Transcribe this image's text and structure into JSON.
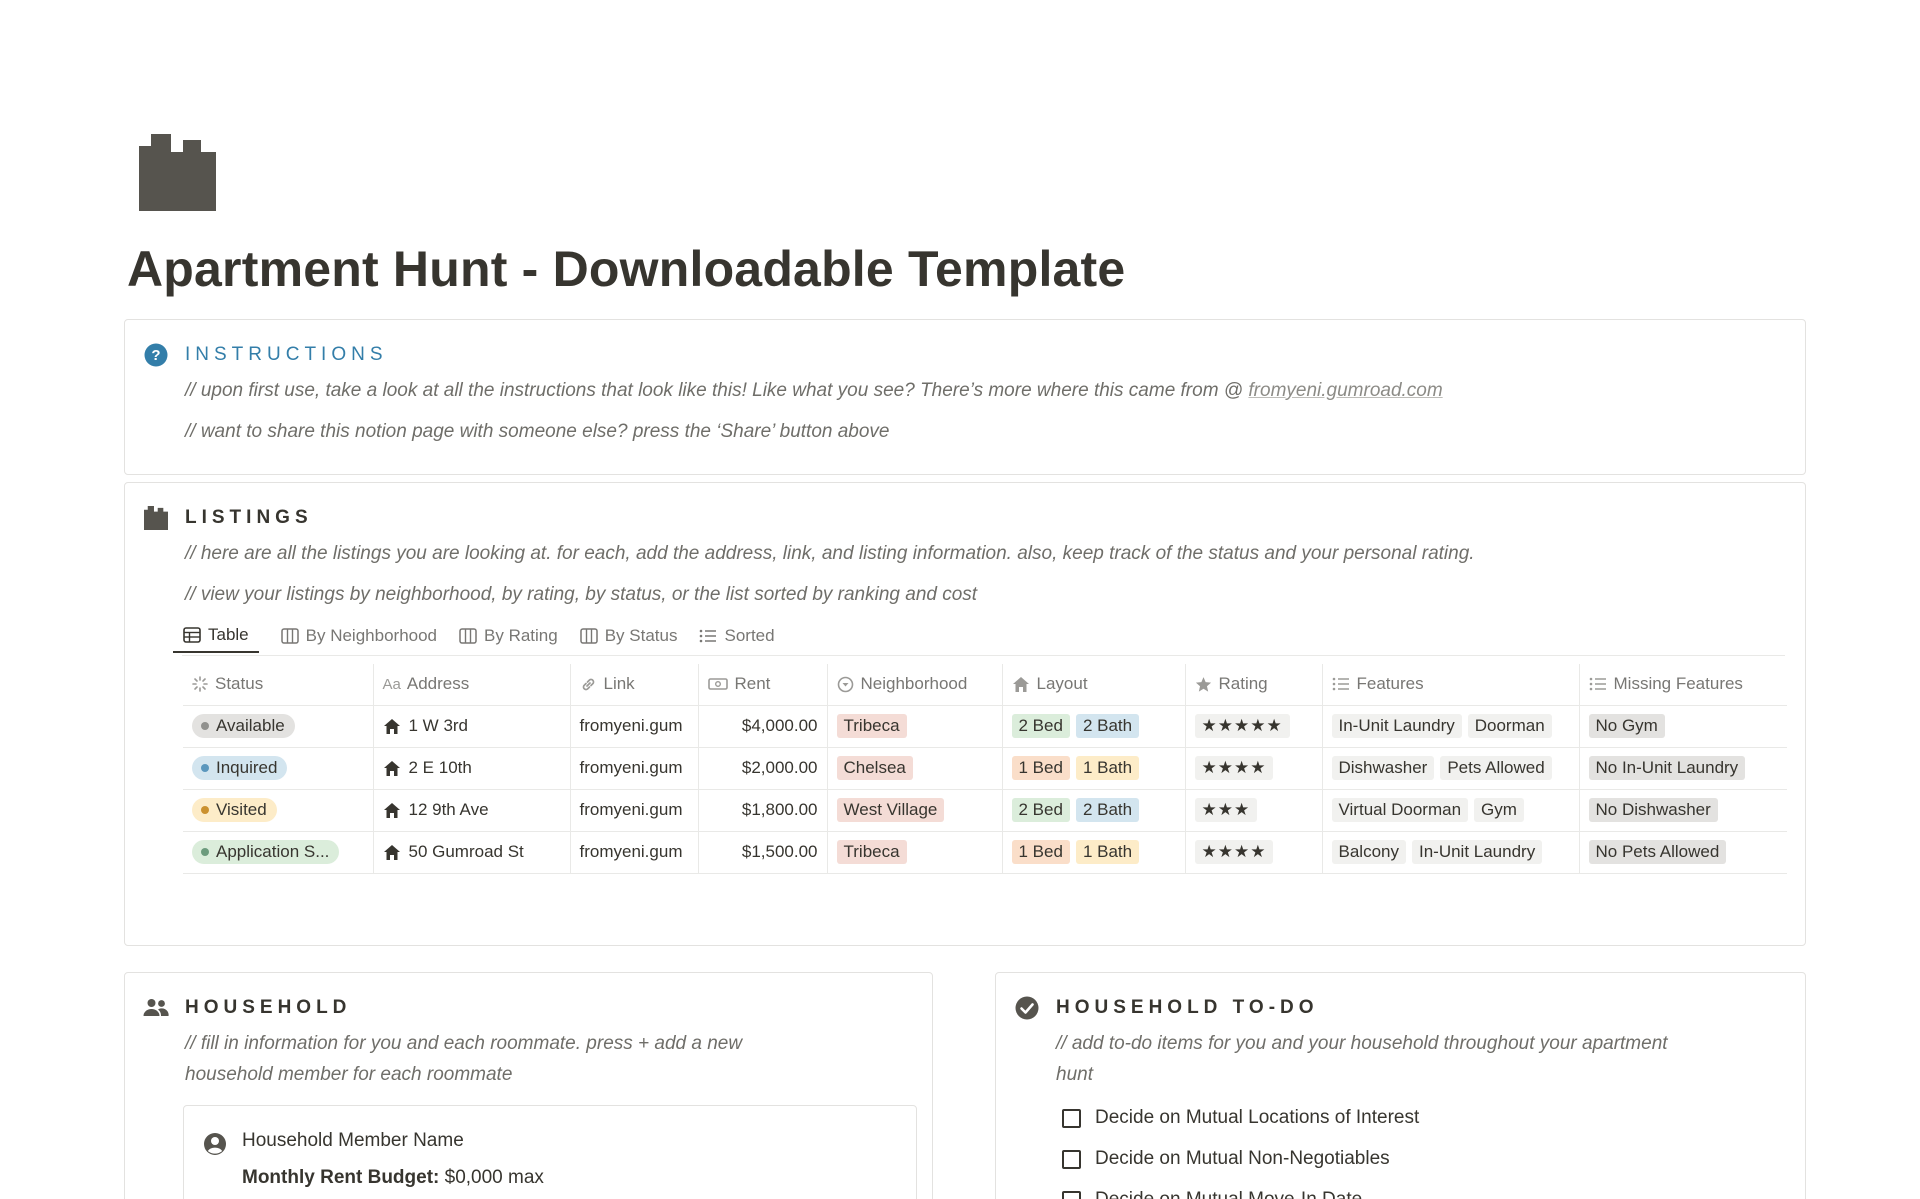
{
  "page": {
    "title": "Apartment Hunt - Downloadable Template",
    "icon": "building-icon"
  },
  "instructions": {
    "heading": "INSTRUCTIONS",
    "icon": "question-circle-icon",
    "icon_color": "#337ea9",
    "line1_text": "// upon first use, take a look at all the instructions that look like this! Like what you see? There’s more where this came from @ ",
    "line1_link": "fromyeni.gumroad.com",
    "line2": "// want to share this notion page with someone else? press the ‘Share’ button above"
  },
  "listings": {
    "heading": "LISTINGS",
    "icon": "building-icon",
    "note1": "// here are all the listings you are looking at. for each, add the address, link, and listing information. also, keep track of the status and your personal rating.",
    "note2": "// view your listings by neighborhood, by rating, by status, or the list sorted by ranking and cost",
    "tabs": [
      {
        "label": "Table",
        "icon": "table-icon",
        "active": true
      },
      {
        "label": "By Neighborhood",
        "icon": "board-icon",
        "active": false
      },
      {
        "label": "By Rating",
        "icon": "board-icon",
        "active": false
      },
      {
        "label": "By Status",
        "icon": "board-icon",
        "active": false
      },
      {
        "label": "Sorted",
        "icon": "list-icon",
        "active": false
      }
    ],
    "columns": [
      {
        "label": "Status",
        "icon": "status-icon"
      },
      {
        "label": "Address",
        "icon": "text-aa-icon"
      },
      {
        "label": "Link",
        "icon": "link-icon"
      },
      {
        "label": "Rent",
        "icon": "money-icon"
      },
      {
        "label": "Neighborhood",
        "icon": "select-icon"
      },
      {
        "label": "Layout",
        "icon": "home-icon"
      },
      {
        "label": "Rating",
        "icon": "star-icon"
      },
      {
        "label": "Features",
        "icon": "multi-select-icon"
      },
      {
        "label": "Missing Features",
        "icon": "multi-select-icon"
      }
    ],
    "rows": [
      {
        "status": "Available",
        "address": "1 W 3rd",
        "link": "fromyeni.gum",
        "rent": "$4,000.00",
        "neighborhood": "Tribeca",
        "bed": "2 Bed",
        "bath": "2 Bath",
        "rating": "★★★★★",
        "features": [
          "In-Unit Laundry",
          "Doorman"
        ],
        "missing": "No Gym"
      },
      {
        "status": "Inquired",
        "address": "2 E 10th",
        "link": "fromyeni.gum",
        "rent": "$2,000.00",
        "neighborhood": "Chelsea",
        "bed": "1 Bed",
        "bath": "1 Bath",
        "rating": "★★★★",
        "features": [
          "Dishwasher",
          "Pets Allowed"
        ],
        "missing": "No In-Unit Laundry"
      },
      {
        "status": "Visited",
        "address": "12 9th Ave",
        "link": "fromyeni.gum",
        "rent": "$1,800.00",
        "neighborhood": "West Village",
        "bed": "2 Bed",
        "bath": "2 Bath",
        "rating": "★★★",
        "features": [
          "Virtual Doorman",
          "Gym"
        ],
        "missing": "No Dishwasher"
      },
      {
        "status": "Application S...",
        "address": "50 Gumroad St",
        "link": "fromyeni.gum",
        "rent": "$1,500.00",
        "neighborhood": "Tribeca",
        "bed": "1 Bed",
        "bath": "1 Bath",
        "rating": "★★★★",
        "features": [
          "Balcony",
          "In-Unit Laundry"
        ],
        "missing": "No Pets Allowed"
      }
    ]
  },
  "household": {
    "heading": "HOUSEHOLD",
    "icon": "people-icon",
    "note_line1": "// fill in information for you and each roommate. press + add a new",
    "note_line2": "household member for each roommate",
    "member_name": "Household Member Name",
    "budget_label": "Monthly Rent Budget:",
    "budget_value": " $0,000 max"
  },
  "todo": {
    "heading": "HOUSEHOLD TO-DO",
    "icon": "check-circle-icon",
    "note_line1": "// add to-do items for you and your household throughout your apartment",
    "note_line2": "hunt",
    "items": [
      "Decide on Mutual Locations of Interest",
      "Decide on Mutual Non-Negotiables",
      "Decide on Mutual Move-In Date"
    ]
  },
  "colors": {
    "text": "#37352f",
    "muted": "#787774",
    "status_available_bg": "#e3e2e0",
    "status_available_dot": "#91918e",
    "status_inquired_bg": "#d3e5ef",
    "status_inquired_dot": "#5b97bd",
    "status_visited_bg": "#fdecc8",
    "status_visited_dot": "#cb912f",
    "status_application_bg": "#dbeddb",
    "status_application_dot": "#6c9b7d",
    "tag_red": "#ffe2dd",
    "tag_green": "#dbeddb",
    "tag_blue": "#d3e5ef",
    "tag_orange": "#fadec9",
    "tag_yellow": "#fdecc8",
    "tag_gray": "#e3e2e0",
    "tag_light": "#f1f1ef"
  }
}
